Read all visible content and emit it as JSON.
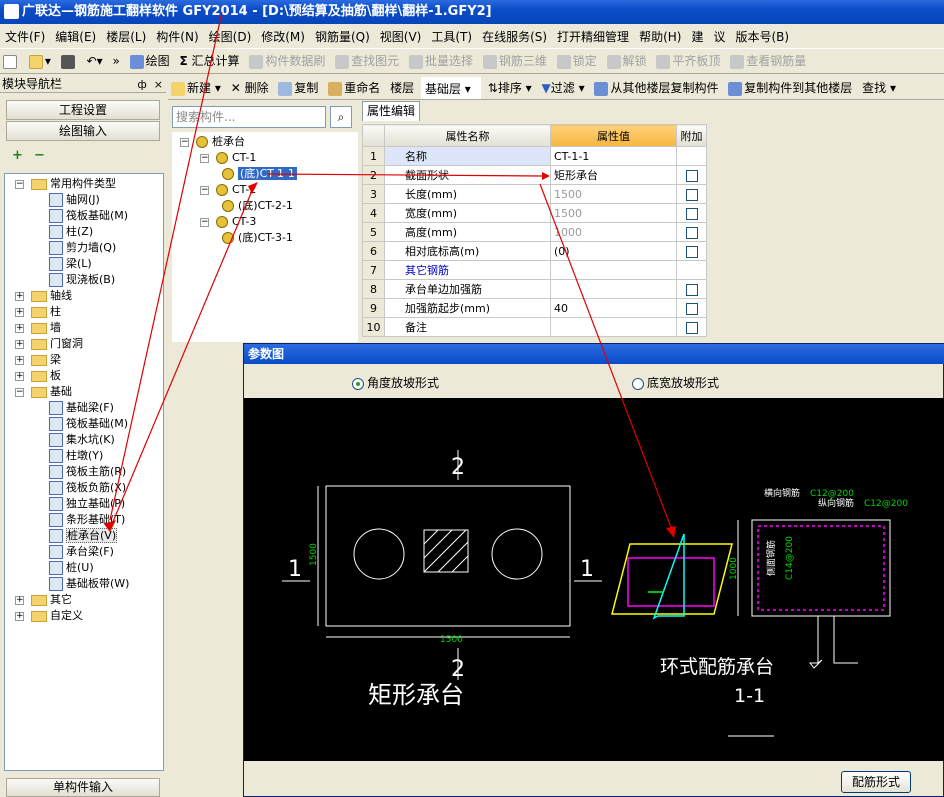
{
  "window": {
    "title": "广联达—钢筋施工翻样软件 GFY2014 - [D:\\预结算及抽筋\\翻样\\翻样-1.GFY2]"
  },
  "menu": [
    "文件(F)",
    "编辑(E)",
    "楼层(L)",
    "构件(N)",
    "绘图(D)",
    "修改(M)",
    "钢筋量(Q)",
    "视图(V)",
    "工具(T)",
    "在线服务(S)",
    "打开精细管理",
    "帮助(H)",
    "建",
    "议",
    "版本号(B)"
  ],
  "toolbar": {
    "draw": "绘图",
    "sum": "汇总计算",
    "items_disabled": [
      "构件数据刷",
      "查找图元",
      "批量选择",
      "钢筋三维",
      "锁定",
      "解锁",
      "平齐板顶",
      "查看钢筋量"
    ]
  },
  "nav": {
    "title": "模块导航栏",
    "pin": "ф",
    "close": "×",
    "settings_btn": "工程设置",
    "draw_btn": "绘图输入",
    "bottom_btn": "单构件输入",
    "tree": [
      {
        "label": "常用构件类型",
        "level": 0,
        "kind": "folder",
        "pm": "−"
      },
      {
        "label": "轴网(J)",
        "level": 1,
        "kind": "comp"
      },
      {
        "label": "筏板基础(M)",
        "level": 1,
        "kind": "comp"
      },
      {
        "label": "柱(Z)",
        "level": 1,
        "kind": "comp"
      },
      {
        "label": "剪力墙(Q)",
        "level": 1,
        "kind": "comp"
      },
      {
        "label": "梁(L)",
        "level": 1,
        "kind": "comp"
      },
      {
        "label": "现浇板(B)",
        "level": 1,
        "kind": "comp"
      },
      {
        "label": "轴线",
        "level": 0,
        "kind": "folder",
        "pm": "+"
      },
      {
        "label": "柱",
        "level": 0,
        "kind": "folder",
        "pm": "+"
      },
      {
        "label": "墙",
        "level": 0,
        "kind": "folder",
        "pm": "+"
      },
      {
        "label": "门窗洞",
        "level": 0,
        "kind": "folder",
        "pm": "+"
      },
      {
        "label": "梁",
        "level": 0,
        "kind": "folder",
        "pm": "+"
      },
      {
        "label": "板",
        "level": 0,
        "kind": "folder",
        "pm": "+"
      },
      {
        "label": "基础",
        "level": 0,
        "kind": "folder",
        "pm": "−"
      },
      {
        "label": "基础梁(F)",
        "level": 1,
        "kind": "comp"
      },
      {
        "label": "筏板基础(M)",
        "level": 1,
        "kind": "comp"
      },
      {
        "label": "集水坑(K)",
        "level": 1,
        "kind": "comp"
      },
      {
        "label": "柱墩(Y)",
        "level": 1,
        "kind": "comp"
      },
      {
        "label": "筏板主筋(R)",
        "level": 1,
        "kind": "comp"
      },
      {
        "label": "筏板负筋(X)",
        "level": 1,
        "kind": "comp"
      },
      {
        "label": "独立基础(P)",
        "level": 1,
        "kind": "comp"
      },
      {
        "label": "条形基础(T)",
        "level": 1,
        "kind": "comp"
      },
      {
        "label": "桩承台(V)",
        "level": 1,
        "kind": "comp",
        "selected": true
      },
      {
        "label": "承台梁(F)",
        "level": 1,
        "kind": "comp"
      },
      {
        "label": "桩(U)",
        "level": 1,
        "kind": "comp"
      },
      {
        "label": "基础板带(W)",
        "level": 1,
        "kind": "comp"
      },
      {
        "label": "其它",
        "level": 0,
        "kind": "folder",
        "pm": "+"
      },
      {
        "label": "自定义",
        "level": 0,
        "kind": "folder",
        "pm": "+"
      }
    ]
  },
  "secbar": {
    "new": "新建",
    "delete": "删除",
    "copy": "复制",
    "rename": "重命名",
    "floor_label": "楼层",
    "floor_value": "基础层",
    "sort": "排序",
    "filter": "过滤",
    "copy_from": "从其他楼层复制构件",
    "copy_to": "复制构件到其他楼层",
    "find": "查找"
  },
  "search": {
    "placeholder": "搜索构件..."
  },
  "comp_tree": [
    {
      "label": "桩承台",
      "level": 0
    },
    {
      "label": "CT-1",
      "level": 1
    },
    {
      "label": "(底)CT-1-1",
      "level": 2,
      "selected": true
    },
    {
      "label": "CT-2",
      "level": 1
    },
    {
      "label": "(底)CT-2-1",
      "level": 2
    },
    {
      "label": "CT-3",
      "level": 1
    },
    {
      "label": "(底)CT-3-1",
      "level": 2
    }
  ],
  "props": {
    "tab": "属性编辑",
    "headers": [
      "属性名称",
      "属性值",
      "附加"
    ],
    "rows": [
      {
        "n": "1",
        "name": "名称",
        "value": "CT-1-1",
        "cb": false,
        "style": "sel"
      },
      {
        "n": "2",
        "name": "截面形状",
        "value": "矩形承台",
        "cb": true,
        "style": ""
      },
      {
        "n": "3",
        "name": "长度(mm)",
        "value": "1500",
        "cb": true,
        "style": "gray"
      },
      {
        "n": "4",
        "name": "宽度(mm)",
        "value": "1500",
        "cb": true,
        "style": "gray"
      },
      {
        "n": "5",
        "name": "高度(mm)",
        "value": "1000",
        "cb": true,
        "style": "gray"
      },
      {
        "n": "6",
        "name": "相对底标高(m)",
        "value": "(0)",
        "cb": true,
        "style": ""
      },
      {
        "n": "7",
        "name": "其它钢筋",
        "value": "",
        "cb": false,
        "style": "blue"
      },
      {
        "n": "8",
        "name": "承台单边加强筋",
        "value": "",
        "cb": true,
        "style": ""
      },
      {
        "n": "9",
        "name": "加强筋起步(mm)",
        "value": "40",
        "cb": true,
        "style": ""
      },
      {
        "n": "10",
        "name": "备注",
        "value": "",
        "cb": true,
        "style": ""
      }
    ]
  },
  "dialog": {
    "title": "参数图",
    "option_a": "角度放坡形式",
    "option_b": "底宽放坡形式",
    "ok": "配筋形式",
    "drawing": {
      "sec_top": "2",
      "sec_bottom": "2",
      "sec_left": "1",
      "sec_right": "1",
      "dim_vert": "1500",
      "dim_horiz": "1500",
      "left_title": "矩形承台",
      "right_title": "环式配筋承台",
      "section": "1-1",
      "h_bar_label": "横向钢筋",
      "h_bar_spec": "C12@200",
      "v_bar_label": "纵向钢筋",
      "v_bar_spec": "C12@200",
      "side_bar_label": "侧面钢筋",
      "side_bar_spec": "C14@200",
      "dim_height": "1000",
      "colors": {
        "white": "#ffffff",
        "green": "#00d800",
        "magenta": "#ff00ff",
        "yellow": "#ffff00",
        "cyan": "#00ffff",
        "red": "#e00000"
      }
    }
  }
}
